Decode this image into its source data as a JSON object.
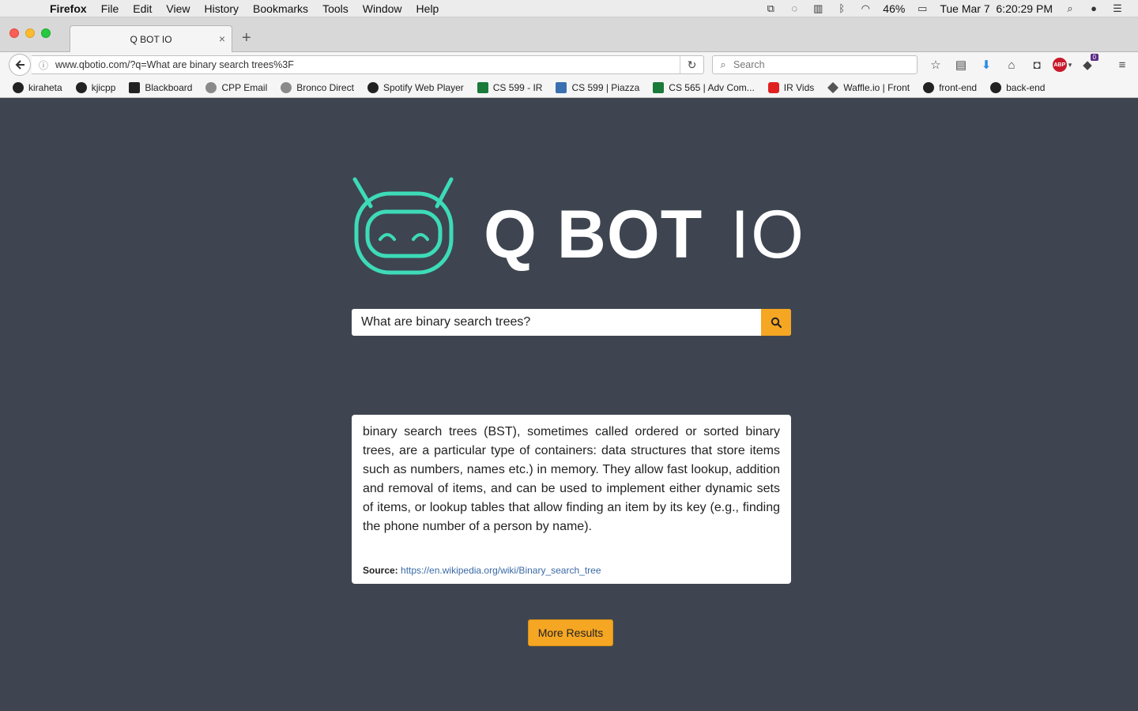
{
  "menubar": {
    "app": "Firefox",
    "items": [
      "File",
      "Edit",
      "View",
      "History",
      "Bookmarks",
      "Tools",
      "Window",
      "Help"
    ],
    "battery": "46%",
    "clock": "Tue Mar 7  6:20:29 PM"
  },
  "tab": {
    "title": "Q BOT IO"
  },
  "navbar": {
    "url": "www.qbotio.com/?q=What are binary search trees%3F",
    "search_placeholder": "Search",
    "notification_count": "0"
  },
  "bookmarks": [
    {
      "label": "kiraheta",
      "icon": "github-icon"
    },
    {
      "label": "kjicpp",
      "icon": "github-icon"
    },
    {
      "label": "Blackboard",
      "icon": "blackboard-icon"
    },
    {
      "label": "CPP Email",
      "icon": "globe-icon"
    },
    {
      "label": "Bronco Direct",
      "icon": "globe-icon"
    },
    {
      "label": "Spotify Web Player",
      "icon": "spotify-icon"
    },
    {
      "label": "CS 599 - IR",
      "icon": "cpp-icon"
    },
    {
      "label": "CS 599 | Piazza",
      "icon": "piazza-icon"
    },
    {
      "label": "CS 565 | Adv Com...",
      "icon": "cpp-icon"
    },
    {
      "label": "IR Vids",
      "icon": "youtube-icon"
    },
    {
      "label": "Waffle.io | Front",
      "icon": "waffle-icon"
    },
    {
      "label": "front-end",
      "icon": "github-icon"
    },
    {
      "label": "back-end",
      "icon": "github-icon"
    }
  ],
  "page": {
    "logo_text": "Q BOT",
    "logo_suffix": "IO",
    "query": "What are binary search trees?",
    "answer": "binary search trees (BST), sometimes called ordered or sorted binary trees, are a particular type of containers: data structures that store items such as numbers, names etc.) in memory. They allow fast lookup, addition and removal of items, and can be used to implement either dynamic sets of items, or lookup tables that allow finding an item by its key (e.g., finding the phone number of a person by name).",
    "source_label": "Source:",
    "source_url": "https://en.wikipedia.org/wiki/Binary_search_tree",
    "more_button": "More Results"
  },
  "colors": {
    "page_bg": "#3e4550",
    "accent": "#f5a623",
    "logo_teal": "#3ddbb8"
  }
}
